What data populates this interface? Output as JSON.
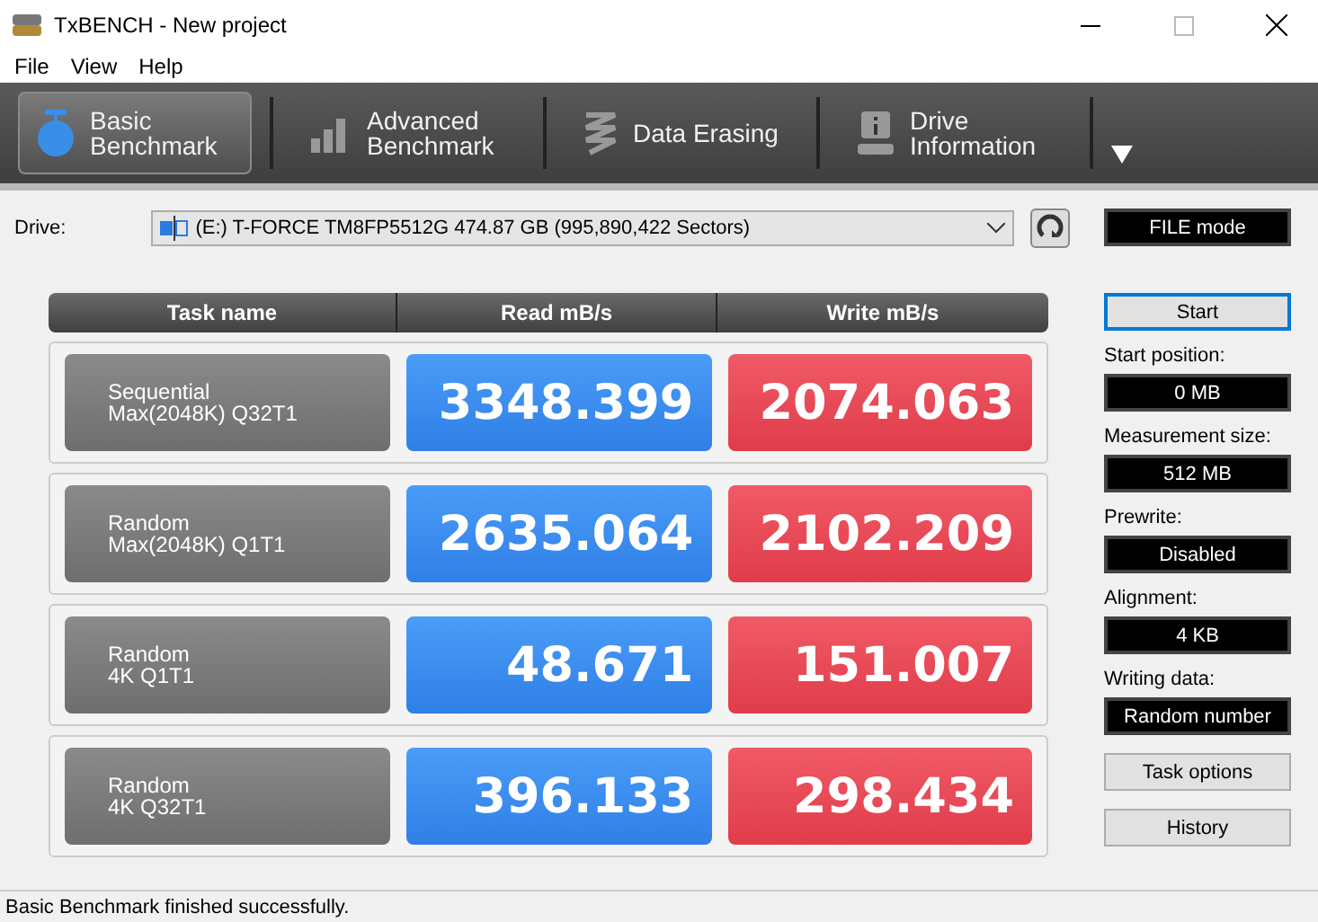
{
  "window": {
    "title": "TxBENCH - New project"
  },
  "menu": [
    "File",
    "View",
    "Help"
  ],
  "tabs": [
    {
      "label": "Basic\nBenchmark",
      "kind": "stopwatch",
      "selected": true
    },
    {
      "label": "Advanced\nBenchmark",
      "kind": "bars",
      "selected": false
    },
    {
      "label": "Data Erasing",
      "kind": "spring",
      "selected": false
    },
    {
      "label": "Drive\nInformation",
      "kind": "info",
      "selected": false
    }
  ],
  "drive": {
    "label": "Drive:",
    "value": "(E:) T-FORCE TM8FP5512G  474.87 GB (995,890,422 Sectors)"
  },
  "mode": "FILE mode",
  "table": {
    "columns": [
      "Task name",
      "Read mB/s",
      "Write mB/s"
    ],
    "rows": [
      {
        "task": "Sequential\nMax(2048K) Q32T1",
        "read": "3348.399",
        "write": "2074.063"
      },
      {
        "task": "Random\nMax(2048K) Q1T1",
        "read": "2635.064",
        "write": "2102.209"
      },
      {
        "task": "Random\n4K Q1T1",
        "read": "48.671",
        "write": "151.007"
      },
      {
        "task": "Random\n4K Q32T1",
        "read": "396.133",
        "write": "298.434"
      }
    ]
  },
  "start_button": "Start",
  "settings": [
    {
      "label": "Start position:",
      "value": "0 MB"
    },
    {
      "label": "Measurement size:",
      "value": "512 MB"
    },
    {
      "label": "Prewrite:",
      "value": "Disabled"
    },
    {
      "label": "Alignment:",
      "value": "4 KB"
    },
    {
      "label": "Writing data:",
      "value": "Random number"
    }
  ],
  "buttons": [
    "Task options",
    "History"
  ],
  "status_bar": "Basic Benchmark finished successfully."
}
